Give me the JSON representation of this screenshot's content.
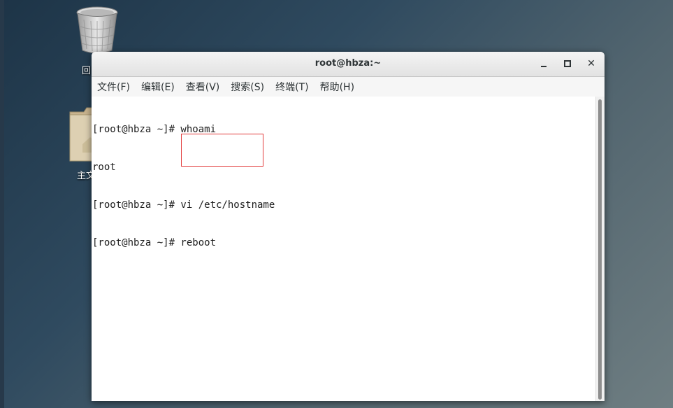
{
  "desktop": {
    "icons": [
      {
        "name": "trash",
        "label": "回"
      },
      {
        "name": "home",
        "label": "主文"
      }
    ]
  },
  "window": {
    "title": "root@hbza:~",
    "controls": {
      "minimize": "minimize-icon",
      "maximize": "maximize-icon",
      "close": "close-icon",
      "close_glyph": "✕"
    }
  },
  "menu": {
    "items": [
      "文件(F)",
      "编辑(E)",
      "查看(V)",
      "搜索(S)",
      "终端(T)",
      "帮助(H)"
    ]
  },
  "terminal": {
    "lines": [
      "[root@hbza ~]# whoami",
      "root",
      "[root@hbza ~]# vi /etc/hostname",
      "[root@hbza ~]# reboot"
    ]
  },
  "colors": {
    "highlight": "#e23b3b"
  }
}
